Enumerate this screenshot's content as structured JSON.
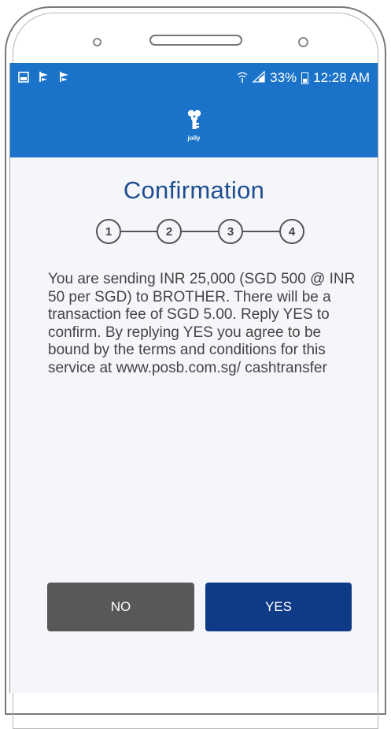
{
  "status_bar": {
    "notification_icons": [
      "image-icon",
      "flag-icon",
      "flag-icon"
    ],
    "battery_percent": "33%",
    "time": "12:28 AM"
  },
  "app_bar": {
    "logo_name": "jolly"
  },
  "page": {
    "title": "Confirmation",
    "steps": [
      "1",
      "2",
      "3",
      "4"
    ],
    "message": "You are sending INR 25,000 (SGD 500 @ INR 50 per SGD) to BROTHER. There will be a transaction fee of SGD 5.00. Reply YES to confirm. By replying YES you agree to be bound by the terms and conditions for this service at www.posb.com.sg/ cashtransfer"
  },
  "actions": {
    "no_label": "NO",
    "yes_label": "YES"
  },
  "colors": {
    "brand_blue": "#1a72c9",
    "title_blue": "#1f4d8f",
    "yes_button": "#0f3a86",
    "no_button": "#585858"
  }
}
